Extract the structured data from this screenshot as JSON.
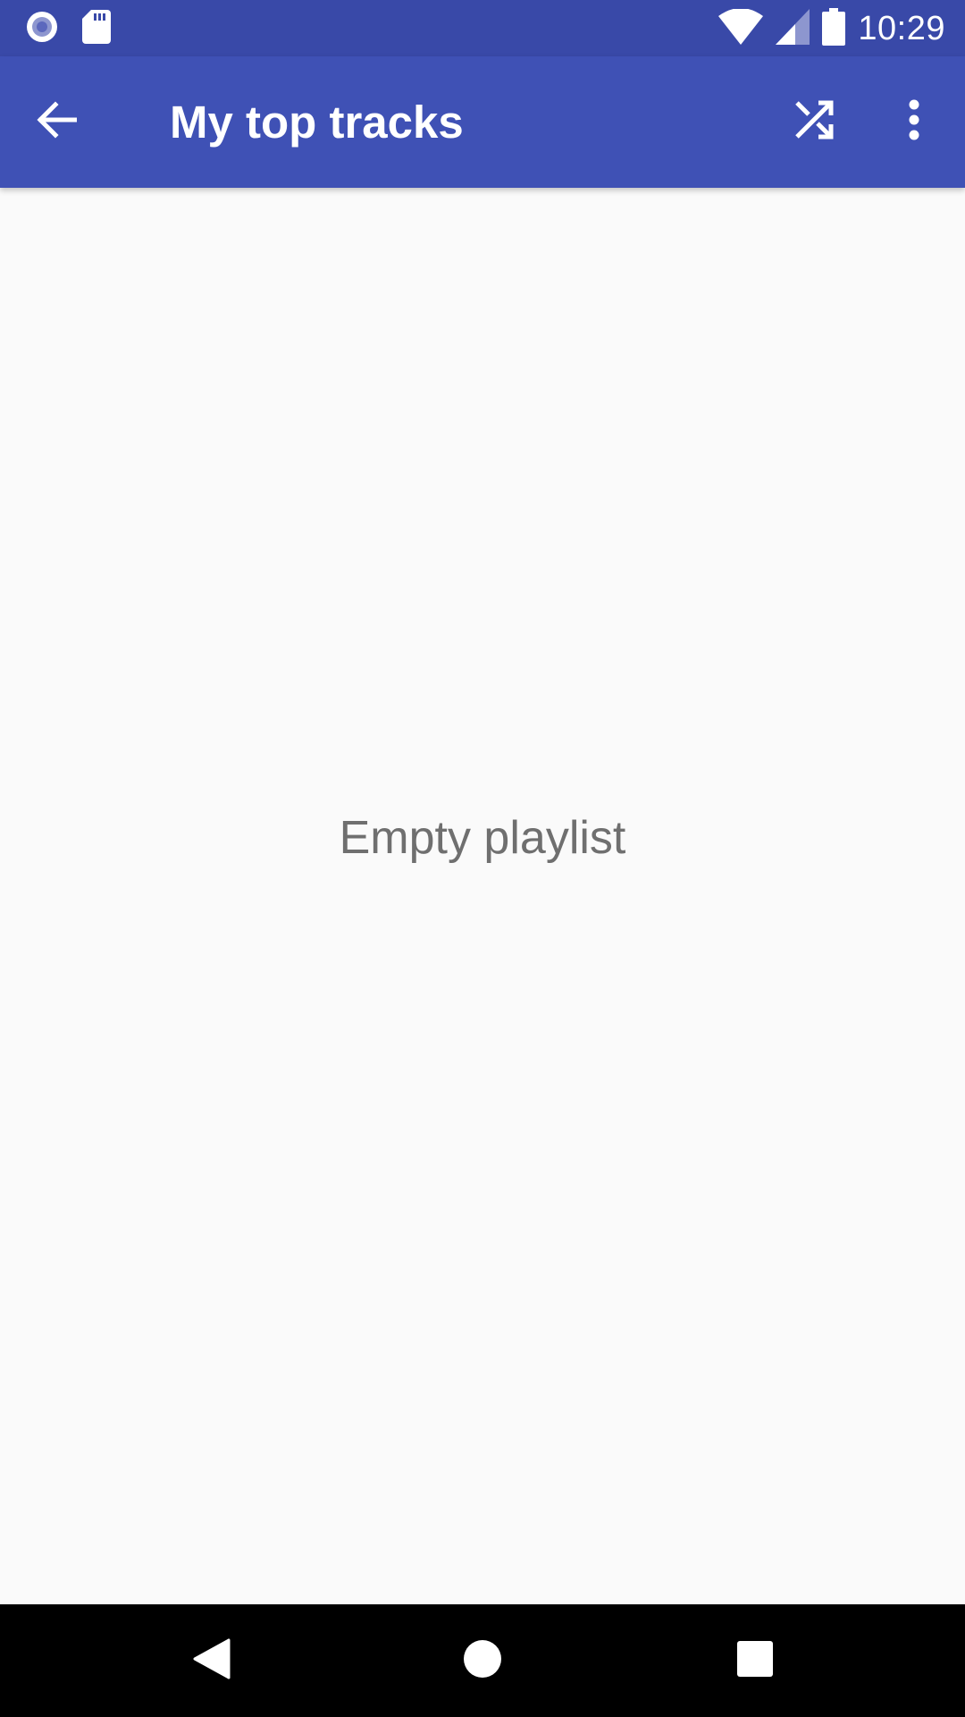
{
  "status_bar": {
    "time": "10:29",
    "icons": [
      "record-icon",
      "sd-card-icon",
      "wifi-icon",
      "signal-icon",
      "battery-icon"
    ]
  },
  "app_bar": {
    "title": "My top tracks",
    "back_icon": "arrow-back-icon",
    "shuffle_icon": "shuffle-icon",
    "overflow_icon": "more-vert-icon"
  },
  "content": {
    "empty_message": "Empty playlist"
  },
  "nav_bar": {
    "icons": [
      "nav-back-icon",
      "nav-home-icon",
      "nav-recents-icon"
    ]
  },
  "colors": {
    "status_bar": "#3949a8",
    "app_bar": "#3f51b5",
    "background": "#fafafa",
    "empty_text": "#6f6f6f",
    "nav_bar": "#000000"
  }
}
